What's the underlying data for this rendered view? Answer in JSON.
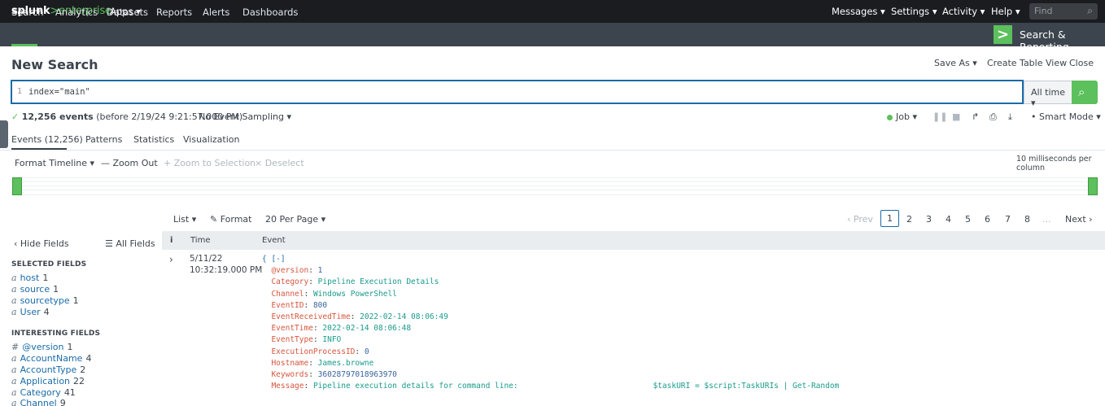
{
  "topbar": {
    "logo_main": "splunk",
    "logo_sep": ">",
    "logo_sub": "enterprise",
    "apps": "Apps ▾",
    "messages": "Messages ▾",
    "settings": "Settings ▾",
    "activity": "Activity ▾",
    "help": "Help ▾",
    "find_placeholder": "Find"
  },
  "nav": {
    "items": [
      "Search",
      "Analytics",
      "Datasets",
      "Reports",
      "Alerts",
      "Dashboards"
    ],
    "app_name": "Search & Reporting"
  },
  "header": {
    "title": "New Search",
    "save_as": "Save As ▾",
    "create_table_view": "Create Table View",
    "close": "Close"
  },
  "search": {
    "line_number": "1",
    "query": "index=\"main\"",
    "time_range": "All time ▾"
  },
  "status": {
    "event_count": "12,256 events",
    "before": "(before 2/19/24 9:21:57.000 PM)",
    "sampling": "No Event Sampling ▾",
    "job": "Job ▾",
    "smart_mode": "Smart Mode ▾"
  },
  "tabs": [
    "Events (12,256)",
    "Patterns",
    "Statistics",
    "Visualization"
  ],
  "timeline": {
    "format": "Format Timeline ▾",
    "zoom_out": "— Zoom Out",
    "zoom_selection": "+ Zoom to Selection",
    "deselect": "× Deselect",
    "scale": "10 milliseconds per column"
  },
  "list_controls": {
    "list": "List ▾",
    "format": "Format",
    "per_page": "20 Per Page ▾"
  },
  "pager": {
    "prev": "‹ Prev",
    "pages": [
      "1",
      "2",
      "3",
      "4",
      "5",
      "6",
      "7",
      "8"
    ],
    "ellipsis": "...",
    "next": "Next ›"
  },
  "sidebar": {
    "hide_fields": "‹ Hide Fields",
    "all_fields": "All Fields",
    "selected_heading": "SELECTED FIELDS",
    "selected": [
      {
        "type": "a",
        "name": "host",
        "count": "1"
      },
      {
        "type": "a",
        "name": "source",
        "count": "1"
      },
      {
        "type": "a",
        "name": "sourcetype",
        "count": "1"
      },
      {
        "type": "a",
        "name": "User",
        "count": "4"
      }
    ],
    "interesting_heading": "INTERESTING FIELDS",
    "interesting": [
      {
        "type": "#",
        "name": "@version",
        "count": "1"
      },
      {
        "type": "a",
        "name": "AccountName",
        "count": "4"
      },
      {
        "type": "a",
        "name": "AccountType",
        "count": "2"
      },
      {
        "type": "a",
        "name": "Application",
        "count": "22"
      },
      {
        "type": "a",
        "name": "Category",
        "count": "41"
      },
      {
        "type": "a",
        "name": "Channel",
        "count": "9"
      }
    ]
  },
  "table": {
    "col_info": "i",
    "col_time": "Time",
    "col_event": "Event",
    "event": {
      "date": "5/11/22",
      "time": "10:32:19.000 PM",
      "open": "{ [-]",
      "fields": [
        {
          "key": "@version",
          "value": "1",
          "numeric": true
        },
        {
          "key": "Category",
          "value": "Pipeline Execution Details",
          "numeric": false
        },
        {
          "key": "Channel",
          "value": "Windows PowerShell",
          "numeric": false
        },
        {
          "key": "EventID",
          "value": "800",
          "numeric": true
        },
        {
          "key": "EventReceivedTime",
          "value": "2022-02-14 08:06:49",
          "numeric": false
        },
        {
          "key": "EventTime",
          "value": "2022-02-14 08:06:48",
          "numeric": false
        },
        {
          "key": "EventType",
          "value": "INFO",
          "numeric": false
        },
        {
          "key": "ExecutionProcessID",
          "value": "0",
          "numeric": true
        },
        {
          "key": "Hostname",
          "value": "James.browne",
          "numeric": false
        },
        {
          "key": "Keywords",
          "value": "36028797018963970",
          "numeric": true
        },
        {
          "key": "Message",
          "value": "Pipeline execution details for command line:                             $taskURI = $script:TaskURIs | Get-Random",
          "numeric": false
        }
      ]
    }
  }
}
